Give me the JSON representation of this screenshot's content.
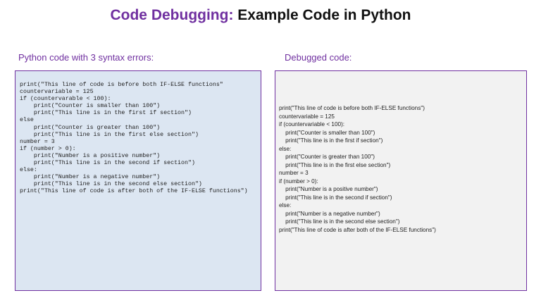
{
  "title": {
    "accent": "Code Debugging:",
    "rest": " Example Code in Python"
  },
  "left_panel": {
    "heading": "Python code with 3 syntax errors:",
    "lines": [
      "print(\"This line of code is before both IF-ELSE functions\"",
      "countervariable = 125",
      "if (countervarable < 100):",
      "    print(\"Counter is smaller than 100\")",
      "    print(\"This line is in the first if section\")",
      "else",
      "    print(\"Counter is greater than 100\")",
      "    print(\"This line is in the first else section\")",
      "number = 3",
      "if (number > 0):",
      "    print(\"Number is a positive number\")",
      "    print(\"This line is in the second if section\")",
      "else:",
      "    print(\"Number is a negative number\")",
      "    print(\"This line is in the second else section\")",
      "print(\"This line of code is after both of the IF-ELSE functions\")"
    ]
  },
  "right_panel": {
    "heading": "Debugged code:",
    "lines": [
      "print(\"This line of code is before both IF-ELSE functions\")",
      "countervariable = 125",
      "if (countervariable < 100):",
      "    print(\"Counter is smaller than 100\")",
      "    print(\"This line is in the first if section\")",
      "else:",
      "    print(\"Counter is greater than 100\")",
      "    print(\"This line is in the first else section\")",
      "number = 3",
      "if (number > 0):",
      "    print(\"Number is a positive number\")",
      "    print(\"This line is in the second if section\")",
      "else:",
      "    print(\"Number is a negative number\")",
      "    print(\"This line is in the second else section\")",
      "print(\"This line of code is after both of the IF-ELSE functions\")"
    ]
  },
  "colors": {
    "accent": "#7030a0",
    "left_box_bg": "#dce6f2",
    "right_box_bg": "#f2f2f2"
  }
}
